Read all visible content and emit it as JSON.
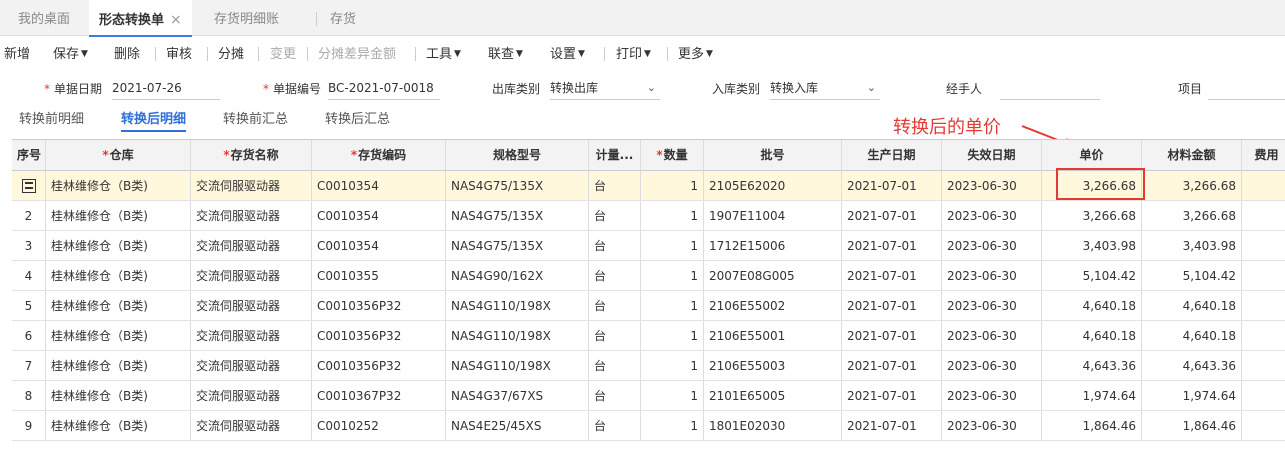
{
  "tabs": [
    {
      "label": "我的桌面"
    },
    {
      "label": "形态转换单",
      "close": "×"
    },
    {
      "label": "存货明细账"
    },
    {
      "label": "存货"
    }
  ],
  "toolbar": {
    "add": "新增",
    "save": "保存",
    "delete": "删除",
    "audit": "审核",
    "allocate": "分摊",
    "change": "变更",
    "allocate_diff": "分摊差异金额",
    "tools": "工具",
    "query": "联查",
    "settings": "设置",
    "print": "打印",
    "more": "更多"
  },
  "form": {
    "date_label": "单据日期",
    "date_value": "2021-07-26",
    "code_label": "单据编号",
    "code_value": "BC-2021-07-0018",
    "out_type_label": "出库类别",
    "out_type_value": "转换出库",
    "in_type_label": "入库类别",
    "in_type_value": "转换入库",
    "handler_label": "经手人",
    "handler_value": "",
    "project_label": "项目",
    "project_value": ""
  },
  "subtabs": [
    "转换前明细",
    "转换后明细",
    "转换前汇总",
    "转换后汇总"
  ],
  "annotation": "转换后的单价",
  "columns": [
    "序号",
    "仓库",
    "存货名称",
    "存货编码",
    "规格型号",
    "计量...",
    "数量",
    "批号",
    "生产日期",
    "失效日期",
    "单价",
    "材料金额",
    "费用"
  ],
  "required_columns": [
    "仓库",
    "存货名称",
    "存货编码",
    "数量"
  ],
  "rows": [
    {
      "no": "",
      "warehouse": "桂林维修仓（B类)",
      "name": "交流伺服驱动器",
      "code": "C0010354",
      "spec": "NAS4G75/135X",
      "unit": "台",
      "qty": "1",
      "batch": "2105E62020",
      "mfg": "2021-07-01",
      "exp": "2023-06-30",
      "price": "3,266.68",
      "amount": "3,266.68"
    },
    {
      "no": "2",
      "warehouse": "桂林维修仓（B类)",
      "name": "交流伺服驱动器",
      "code": "C0010354",
      "spec": "NAS4G75/135X",
      "unit": "台",
      "qty": "1",
      "batch": "1907E11004",
      "mfg": "2021-07-01",
      "exp": "2023-06-30",
      "price": "3,266.68",
      "amount": "3,266.68"
    },
    {
      "no": "3",
      "warehouse": "桂林维修仓（B类)",
      "name": "交流伺服驱动器",
      "code": "C0010354",
      "spec": "NAS4G75/135X",
      "unit": "台",
      "qty": "1",
      "batch": "1712E15006",
      "mfg": "2021-07-01",
      "exp": "2023-06-30",
      "price": "3,403.98",
      "amount": "3,403.98"
    },
    {
      "no": "4",
      "warehouse": "桂林维修仓（B类)",
      "name": "交流伺服驱动器",
      "code": "C0010355",
      "spec": "NAS4G90/162X",
      "unit": "台",
      "qty": "1",
      "batch": "2007E08G005",
      "mfg": "2021-07-01",
      "exp": "2023-06-30",
      "price": "5,104.42",
      "amount": "5,104.42"
    },
    {
      "no": "5",
      "warehouse": "桂林维修仓（B类)",
      "name": "交流伺服驱动器",
      "code": "C0010356P32",
      "spec": "NAS4G110/198X",
      "unit": "台",
      "qty": "1",
      "batch": "2106E55002",
      "mfg": "2021-07-01",
      "exp": "2023-06-30",
      "price": "4,640.18",
      "amount": "4,640.18"
    },
    {
      "no": "6",
      "warehouse": "桂林维修仓（B类)",
      "name": "交流伺服驱动器",
      "code": "C0010356P32",
      "spec": "NAS4G110/198X",
      "unit": "台",
      "qty": "1",
      "batch": "2106E55001",
      "mfg": "2021-07-01",
      "exp": "2023-06-30",
      "price": "4,640.18",
      "amount": "4,640.18"
    },
    {
      "no": "7",
      "warehouse": "桂林维修仓（B类)",
      "name": "交流伺服驱动器",
      "code": "C0010356P32",
      "spec": "NAS4G110/198X",
      "unit": "台",
      "qty": "1",
      "batch": "2106E55003",
      "mfg": "2021-07-01",
      "exp": "2023-06-30",
      "price": "4,643.36",
      "amount": "4,643.36"
    },
    {
      "no": "8",
      "warehouse": "桂林维修仓（B类)",
      "name": "交流伺服驱动器",
      "code": "C0010367P32",
      "spec": "NAS4G37/67XS",
      "unit": "台",
      "qty": "1",
      "batch": "2101E65005",
      "mfg": "2021-07-01",
      "exp": "2023-06-30",
      "price": "1,974.64",
      "amount": "1,974.64"
    },
    {
      "no": "9",
      "warehouse": "桂林维修仓（B类)",
      "name": "交流伺服驱动器",
      "code": "C0010252",
      "spec": "NAS4E25/45XS",
      "unit": "台",
      "qty": "1",
      "batch": "1801E02030",
      "mfg": "2021-07-01",
      "exp": "2023-06-30",
      "price": "1,864.46",
      "amount": "1,864.46"
    }
  ]
}
